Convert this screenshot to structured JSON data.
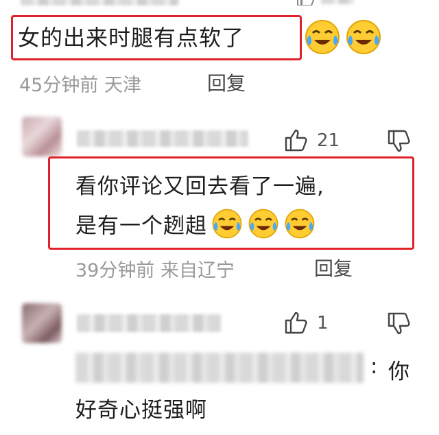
{
  "comment1": {
    "text": "女的出来时腿有点软了",
    "time": "45分钟前",
    "location": "天津",
    "reply_label": "回复",
    "emoji_count": 2
  },
  "comment2": {
    "likes": "21",
    "text_line1": "看你评论又回去看了一遍,",
    "text_line2": "是有一个趔趄",
    "time": "39分钟前",
    "location": "来自辽宁",
    "reply_label": "回复",
    "emoji_count": 3
  },
  "comment3": {
    "likes": "1",
    "colon": ":",
    "text_tail": "你",
    "text_line2": "好奇心挺强啊"
  },
  "colors": {
    "highlight_border": "#e0212a",
    "meta_text": "#9a9a9a"
  },
  "icons": [
    "thumb-up-icon",
    "thumb-down-icon",
    "crying-laughing-emoji"
  ]
}
